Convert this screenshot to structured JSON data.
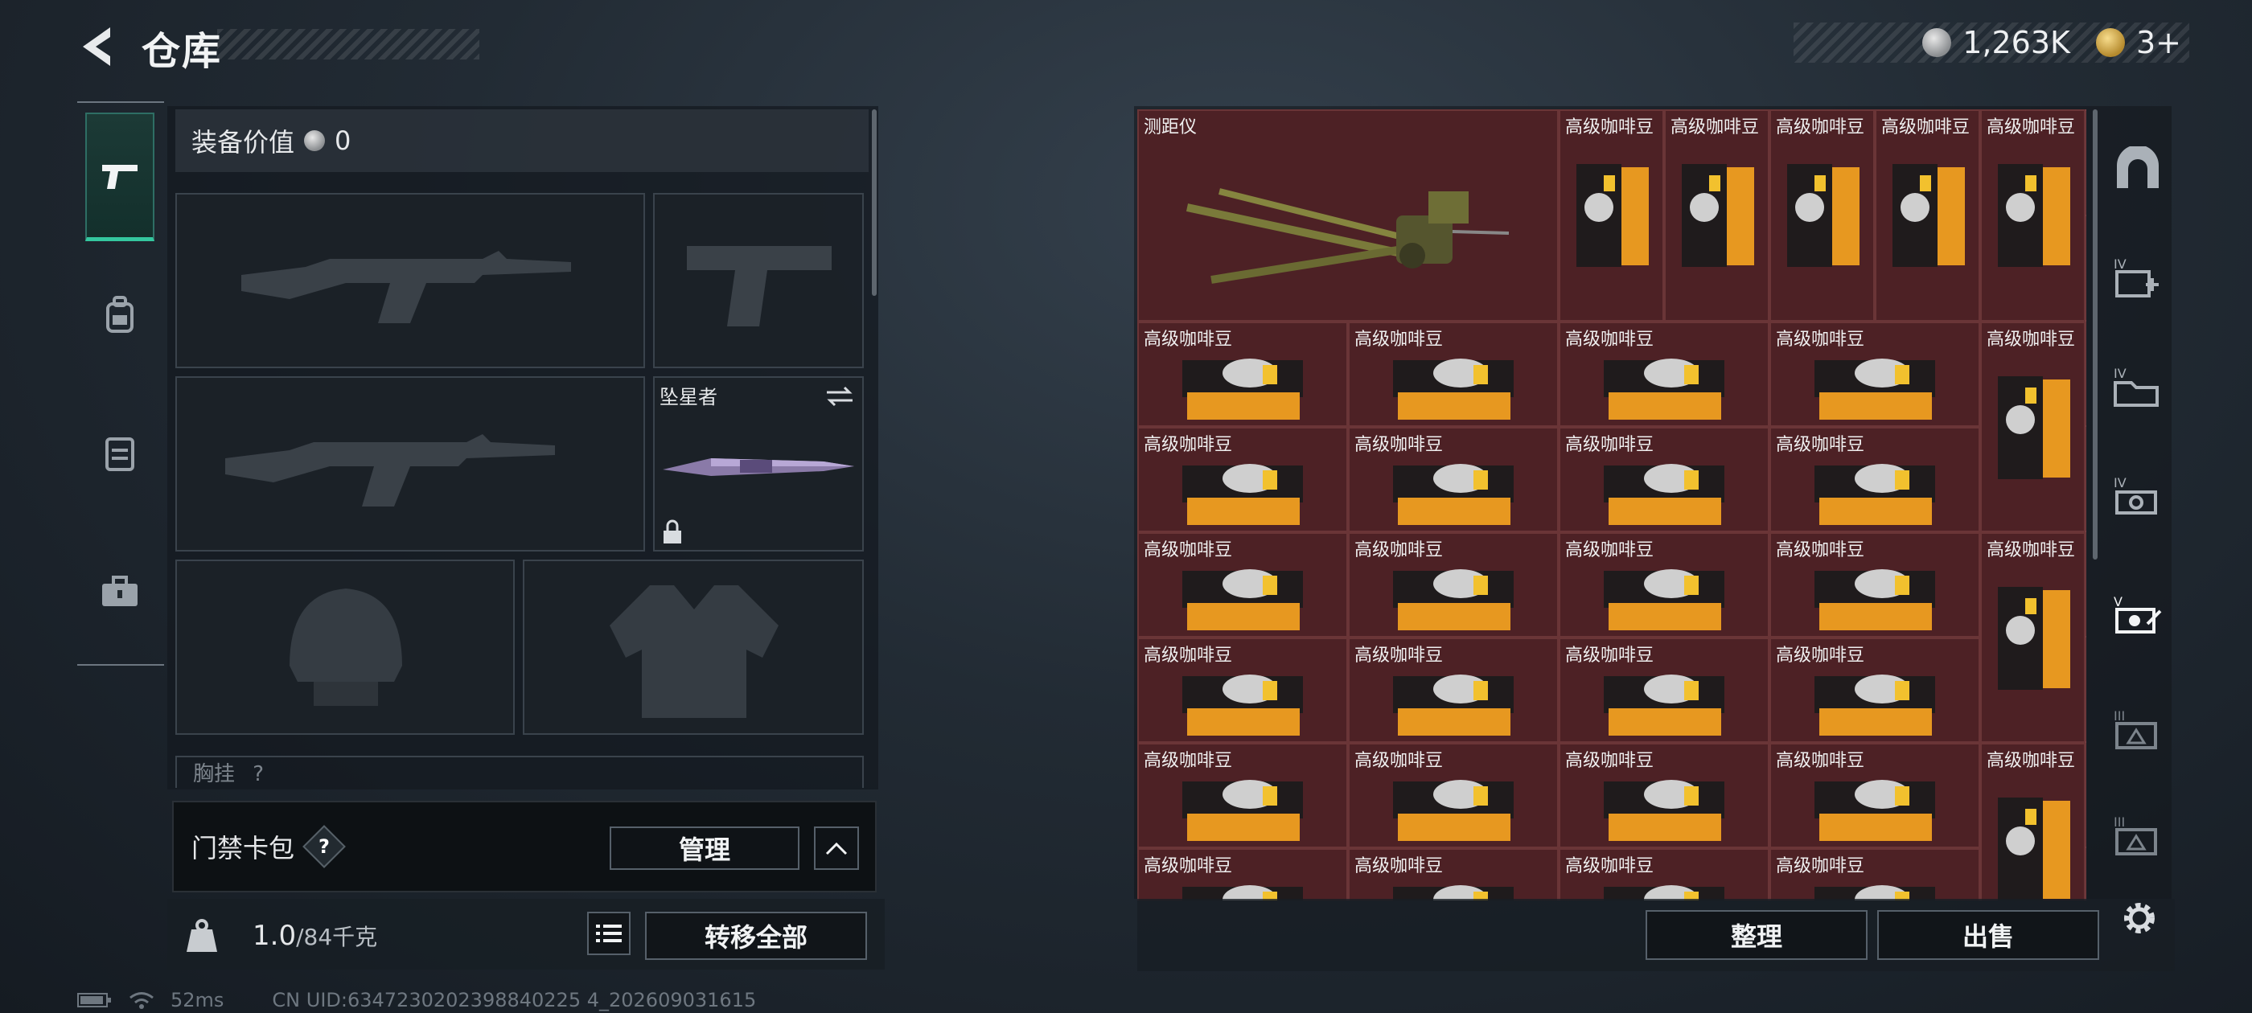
{
  "header": {
    "title": "仓库"
  },
  "currency": {
    "silver": "1,263K",
    "gold": "3+"
  },
  "categories": [
    "weapons",
    "backpack",
    "armor",
    "medkit"
  ],
  "equipment": {
    "value_label": "装备价值",
    "value": "0",
    "melee_name": "坠星者",
    "chest_rig_label": "胸挂",
    "chest_rig_hint": "?"
  },
  "access_card": {
    "title": "门禁卡包",
    "help": "?",
    "manage_label": "管理"
  },
  "weight": {
    "current": "1.0",
    "max": "/84千克"
  },
  "transfer_all_label": "转移全部",
  "status": {
    "ping": "52ms",
    "uid": "CN UID:6347230202398840225 4_202609031615"
  },
  "storage": {
    "rangefinder": "测距仪",
    "coffee": "高级咖啡豆"
  },
  "actions": {
    "sort_label": "整理",
    "sell_label": "出售"
  }
}
